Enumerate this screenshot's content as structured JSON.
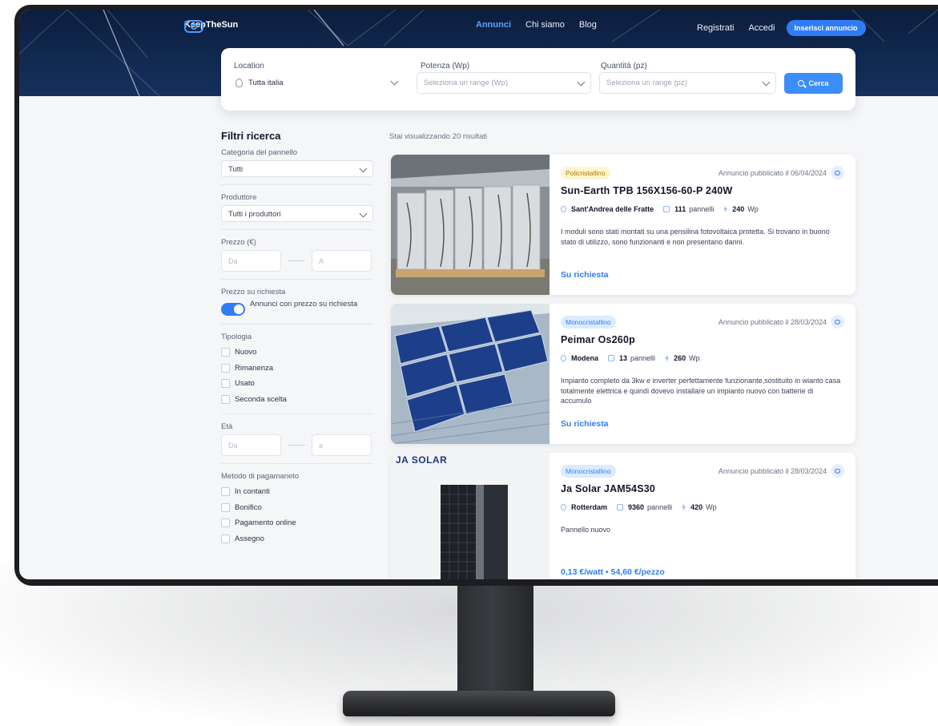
{
  "header": {
    "brand": "KeepTheSun",
    "nav": [
      "Annunci",
      "Chi siamo",
      "Blog"
    ],
    "register": "Registrati",
    "login": "Accedi",
    "cta": "Inserisci annuncio"
  },
  "search": {
    "location_label": "Location",
    "location_value": "Tutta italia",
    "power_label": "Potenza (Wp)",
    "power_placeholder": "Seleziona un range (Wp)",
    "qty_label": "Quantità (pz)",
    "qty_placeholder": "Seleziona un range (pz)",
    "button": "Cerca"
  },
  "filters": {
    "title": "Filtri ricerca",
    "category_label": "Categoria del pannello",
    "category_value": "Tutti",
    "producer_label": "Produttore",
    "producer_value": "Tutti i produttori",
    "price_label": "Prezzo (€)",
    "price_from": "Da",
    "price_to": "A",
    "on_request_label": "Prezzo su richiesta",
    "on_request_toggle": "Annunci con prezzo su richiesta",
    "type_label": "Tipologia",
    "types": [
      "Nuovo",
      "Rimanenza",
      "Usato",
      "Seconda scelta"
    ],
    "age_label": "Età",
    "age_from": "Da",
    "age_to": "a",
    "payment_label": "Metodo di pagamaneto",
    "payments": [
      "In contanti",
      "Bonifico",
      "Pagamento online",
      "Assegno"
    ]
  },
  "results": {
    "count_text": "Stai visualizzando 20 risultati",
    "listings": [
      {
        "badge": "Policristallino",
        "published": "Annuncio pubblicato il 06/04/2024",
        "title": "Sun-Earth TPB 156X156-60-P 240W",
        "location": "Sant'Andrea delle Fratte",
        "panels_num": "111",
        "panels_word": "pannelli",
        "wp_num": "240",
        "wp_unit": "Wp",
        "description": "I moduli sono stati montati su una pensilina fotovoltaica protetta. Si trovano in buono stato di utilizzo, sono funzionanti e non presentano danni.",
        "price": "Su richiesta"
      },
      {
        "badge": "Monocristallino",
        "published": "Annuncio pubblicato il 28/03/2024",
        "title": "Peimar Os260p",
        "location": "Modena",
        "panels_num": "13",
        "panels_word": "pannelli",
        "wp_num": "260",
        "wp_unit": "Wp",
        "description": "Impianto completo da 3kw e inverter perfettamente funzionante,sostituito in wianto casa totalmente elettrica e quindi dovevo installare un impianto nuovo con batterie di accumulo",
        "price": "Su richiesta"
      },
      {
        "badge": "Monocristallino",
        "published": "Annuncio pubblicato il 28/03/2024",
        "title": "Ja Solar JAM54S30",
        "location": "Rotterdam",
        "panels_num": "9360",
        "panels_word": "pannelli",
        "wp_num": "420",
        "wp_unit": "Wp",
        "description": "Pannello nuovo",
        "price": "0,13 €/watt • 54,60 €/pezzo",
        "image_brand": "JA SOLAR"
      }
    ]
  },
  "colors": {
    "accent": "#2f7df6",
    "header_bg": "#0c1d3d",
    "badge_poly_bg": "#fff6cf",
    "badge_mono_bg": "#dcecff"
  }
}
